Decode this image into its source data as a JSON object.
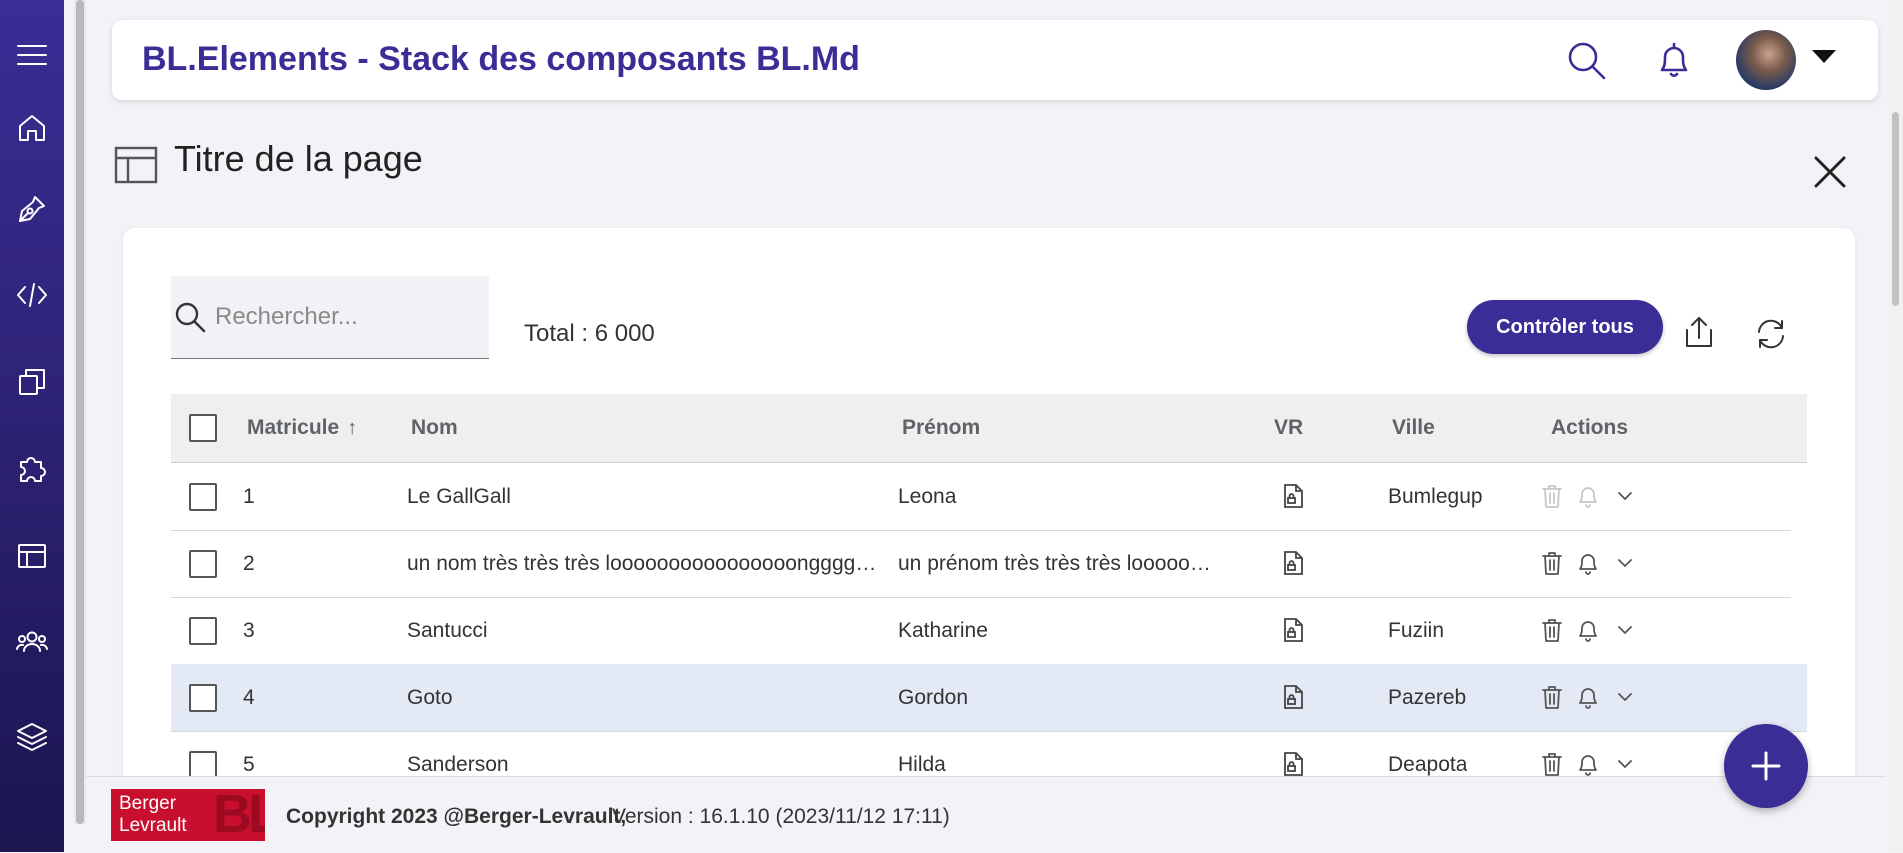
{
  "colors": {
    "brand": "#3a2d96",
    "selected_row": "#e3e9f5",
    "logo_red": "#c8102e"
  },
  "sidebar": {
    "items": [
      {
        "icon": "menu-icon"
      },
      {
        "icon": "home-icon"
      },
      {
        "icon": "pen-icon"
      },
      {
        "icon": "code-icon"
      },
      {
        "icon": "copy-icon"
      },
      {
        "icon": "puzzle-icon"
      },
      {
        "icon": "layout-icon"
      },
      {
        "icon": "users-icon"
      },
      {
        "icon": "layers-icon"
      }
    ]
  },
  "header": {
    "title": "BL.Elements - Stack des composants BL.Md",
    "icons": [
      "search-icon",
      "bell-icon",
      "avatar",
      "chevron-down-icon"
    ]
  },
  "page": {
    "title": "Titre de la page"
  },
  "toolbar": {
    "search_placeholder": "Rechercher...",
    "search_value": "",
    "total": "Total : 6 000",
    "control_all_label": "Contrôler tous"
  },
  "table": {
    "columns": [
      "Matricule",
      "Nom",
      "Prénom",
      "VR",
      "Ville",
      "Actions"
    ],
    "sort": {
      "column": "Matricule",
      "direction": "ascending"
    },
    "rows": [
      {
        "matricule": "1",
        "nom": "Le GallGall",
        "prenom": "Leona",
        "ville": "Bumlegup",
        "actions_disabled": true,
        "selected": false
      },
      {
        "matricule": "2",
        "nom": "un nom très très très loooooooooooooooongggggggg",
        "prenom": "un prénom très très très looooooooooong",
        "ville": "",
        "actions_disabled": false,
        "selected": false
      },
      {
        "matricule": "3",
        "nom": "Santucci",
        "prenom": "Katharine",
        "ville": "Fuziin",
        "actions_disabled": false,
        "selected": false
      },
      {
        "matricule": "4",
        "nom": "Goto",
        "prenom": "Gordon",
        "ville": "Pazereb",
        "actions_disabled": false,
        "selected": true
      },
      {
        "matricule": "5",
        "nom": "Sanderson",
        "prenom": "Hilda",
        "ville": "Deapota",
        "actions_disabled": false,
        "selected": false
      }
    ]
  },
  "footer": {
    "logo_line1": "Berger",
    "logo_line2": "Levrault",
    "logo_mark": "BL",
    "copyright": "Copyright 2023 @Berger-Levrault,",
    "version": "Version : 16.1.10 (2023/11/12 17:11)"
  }
}
